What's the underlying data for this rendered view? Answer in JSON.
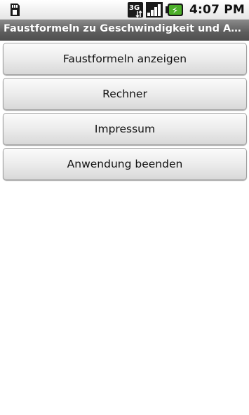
{
  "status_bar": {
    "left_icon": "sd-card-icon",
    "network_label": "3G",
    "signal_icon": "signal-bars-icon",
    "battery_icon": "battery-charging-icon",
    "time": "4:07 PM"
  },
  "app": {
    "title": "Faustformeln zu Geschwindigkeit und Abstand"
  },
  "menu": {
    "items": [
      {
        "label": "Faustformeln anzeigen"
      },
      {
        "label": "Rechner"
      },
      {
        "label": "Impressum"
      },
      {
        "label": "Anwendung beenden"
      }
    ]
  }
}
